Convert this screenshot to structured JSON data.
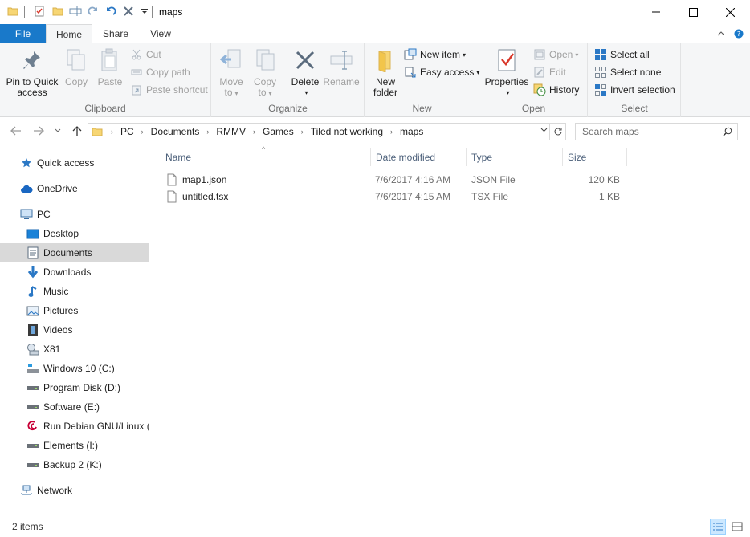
{
  "window": {
    "title": "maps",
    "controls": {
      "minimize": "minimize",
      "maximize": "maximize",
      "close": "close"
    }
  },
  "quick_access_toolbar": {
    "icons": [
      "folder-icon",
      "properties-check-icon",
      "new-folder-icon",
      "rename-icon",
      "redo-icon",
      "undo-icon",
      "delete-x-icon",
      "customize-dropdown-icon"
    ]
  },
  "ribbon": {
    "tabs": [
      {
        "label": "File"
      },
      {
        "label": "Home"
      },
      {
        "label": "Share"
      },
      {
        "label": "View"
      }
    ],
    "groups": {
      "clipboard": {
        "label": "Clipboard",
        "pin": "Pin to Quick\naccess",
        "pin_line1": "Pin to Quick",
        "pin_line2": "access",
        "copy": "Copy",
        "paste": "Paste",
        "cut": "Cut",
        "copy_path": "Copy path",
        "paste_shortcut": "Paste shortcut"
      },
      "organize": {
        "label": "Organize",
        "move_line1": "Move",
        "move_line2": "to",
        "copy_line1": "Copy",
        "copy_line2": "to",
        "delete": "Delete",
        "rename": "Rename"
      },
      "new": {
        "label": "New",
        "new_folder_line1": "New",
        "new_folder_line2": "folder",
        "new_item": "New item",
        "easy_access": "Easy access"
      },
      "open": {
        "label": "Open",
        "properties": "Properties",
        "open": "Open",
        "edit": "Edit",
        "history": "History"
      },
      "select": {
        "label": "Select",
        "select_all": "Select all",
        "select_none": "Select none",
        "invert_selection": "Invert selection"
      }
    }
  },
  "address_bar": {
    "breadcrumbs": [
      "PC",
      "Documents",
      "RMMV",
      "Games",
      "Tiled not working",
      "maps"
    ]
  },
  "search": {
    "placeholder": "Search maps"
  },
  "navigation_pane": {
    "items": [
      {
        "label": "Quick access",
        "icon": "star-icon"
      },
      {
        "label": "OneDrive",
        "icon": "cloud-icon"
      },
      {
        "label": "PC",
        "icon": "pc-icon"
      },
      {
        "label": "Desktop",
        "icon": "desktop-icon"
      },
      {
        "label": "Documents",
        "icon": "documents-icon",
        "selected": true
      },
      {
        "label": "Downloads",
        "icon": "download-arrow-icon"
      },
      {
        "label": "Music",
        "icon": "music-note-icon"
      },
      {
        "label": "Pictures",
        "icon": "pictures-icon"
      },
      {
        "label": "Videos",
        "icon": "film-icon"
      },
      {
        "label": "X81",
        "icon": "network-drive-icon"
      },
      {
        "label": "Windows 10 (C:)",
        "icon": "system-drive-icon"
      },
      {
        "label": "Program Disk (D:)",
        "icon": "drive-icon"
      },
      {
        "label": "Software (E:)",
        "icon": "drive-icon"
      },
      {
        "label": "Run Debian GNU/Linux (",
        "icon": "debian-icon"
      },
      {
        "label": "Elements (I:)",
        "icon": "drive-icon"
      },
      {
        "label": "Backup 2 (K:)",
        "icon": "drive-icon"
      },
      {
        "label": "Network",
        "icon": "network-icon"
      }
    ]
  },
  "file_list": {
    "columns": [
      "Name",
      "Date modified",
      "Type",
      "Size"
    ],
    "rows": [
      {
        "name": "map1.json",
        "date": "7/6/2017 4:16 AM",
        "type": "JSON File",
        "size": "120 KB"
      },
      {
        "name": "untitled.tsx",
        "date": "7/6/2017 4:15 AM",
        "type": "TSX File",
        "size": "1 KB"
      }
    ]
  },
  "status_bar": {
    "item_count": "2 items"
  },
  "colors": {
    "file_tab": "#1979ca",
    "selected_nav": "#d9d9d9",
    "header_text": "#4c607a"
  }
}
